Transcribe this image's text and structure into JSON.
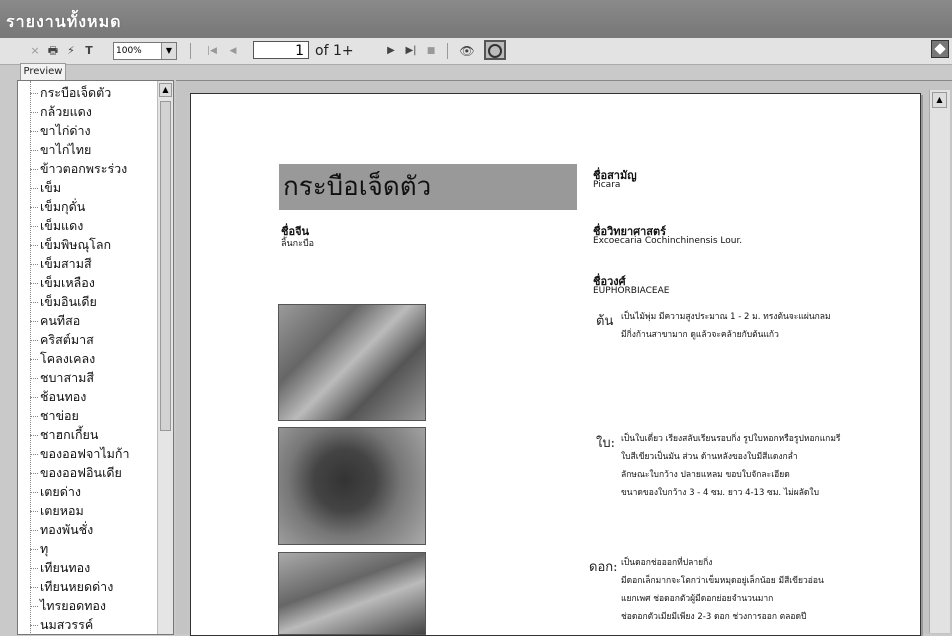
{
  "window": {
    "title": "รายงานทั้งหมด"
  },
  "toolbar": {
    "close_glyph": "×",
    "print_glyph": "🖶",
    "export_glyph": "⚡",
    "text_glyph": "T",
    "zoom": "100%",
    "first_glyph": "|◀",
    "prev_glyph": "◀",
    "page_value": "1",
    "page_of": "of 1+",
    "next_glyph": "▶",
    "last_glyph": "▶|",
    "stop_glyph": "■",
    "find_glyph": "👁"
  },
  "tab": {
    "label": "Preview"
  },
  "sidebar": {
    "items": [
      "กระบือเจ็ดตัว",
      "กล้วยแดง",
      "ขาไก่ด่าง",
      "ขาไก่ไทย",
      "ข้าวตอกพระร่วง",
      "เข็ม",
      "เข็มกุดั่น",
      "เข็มแดง",
      "เข็มพิษณุโลก",
      "เข็มสามสี",
      "เข็มเหลือง",
      "เข็มอินเดีย",
      "คนทีสอ",
      "คริสต์มาส",
      "โคลงเคลง",
      "ชบาสามสี",
      "ช้อนทอง",
      "ชาข่อย",
      "ชาฮกเกี้ยน",
      "ของออฟจาไมก้า",
      "ของออฟอินเดีย",
      "เตยด่าง",
      "เตยหอม",
      "ทองพันชั่ง",
      "ทุ",
      "เทียนทอง",
      "เทียนหยดด่าง",
      "ไทรยอดทอง",
      "นมสวรรค์"
    ]
  },
  "report": {
    "title": "กระบือเจ็ดตัว",
    "local_name_label": "ชื่อจีน",
    "local_name_value": "ลิ้นกะบือ",
    "common_name_label": "ชื่อสามัญ",
    "common_name_value": "Picara",
    "scientific_label": "ชื่อวิทยาศาสตร์",
    "scientific_value": "Excoecaria  Cochinchinensis  Lour.",
    "family_label": "ชื่อวงศ์",
    "family_value": "EUPHORBIACEAE",
    "trunk_label": "ต้น",
    "trunk_lines": [
      "เป็นไม้พุ่ม  มีความสูงประมาณ 1 - 2 ม.  ทรงต้นจะแผ่นกลม",
      "มีกิ่งก้านสาขามาก  ดูแล้วจะคล้ายกับต้นแก้ว"
    ],
    "leaf_label": "ใบ:",
    "leaf_lines": [
      "เป็นใบเดี่ยว  เรียงสลับเรียนรอบกิ่ง  รูปใบหอกหรือรูปหอกแกมรี",
      "ใบสีเขียวเป็นมัน  ส่วน ด้านหลังของใบมีสีแดงกล่ำ",
      "ลักษณะใบกว้าง  ปลายแหลม  ขอบใบจักละเอียด",
      "ขนาดของใบกว้าง 3 - 4  ซม.  ยาว 4-13  ซม.  ไม่ผลัดใบ"
    ],
    "flower_label": "ดอก:",
    "flower_lines": [
      "เป็นดอกช่อออกที่ปลายกิ่ง",
      "มีดอกเล็กมากจะโตกว่าเข็มหมุดอยู่เล็กน้อย  มีสีเขียวอ่อน",
      "แยกเพศ  ช่อดอกตัวผู้มีดอกย่อยจำนวนมาก",
      "ช่อดอกตัวเมียมีเพียง  2-3  ดอก  ช่วงการออก  ตลอดปี"
    ]
  }
}
